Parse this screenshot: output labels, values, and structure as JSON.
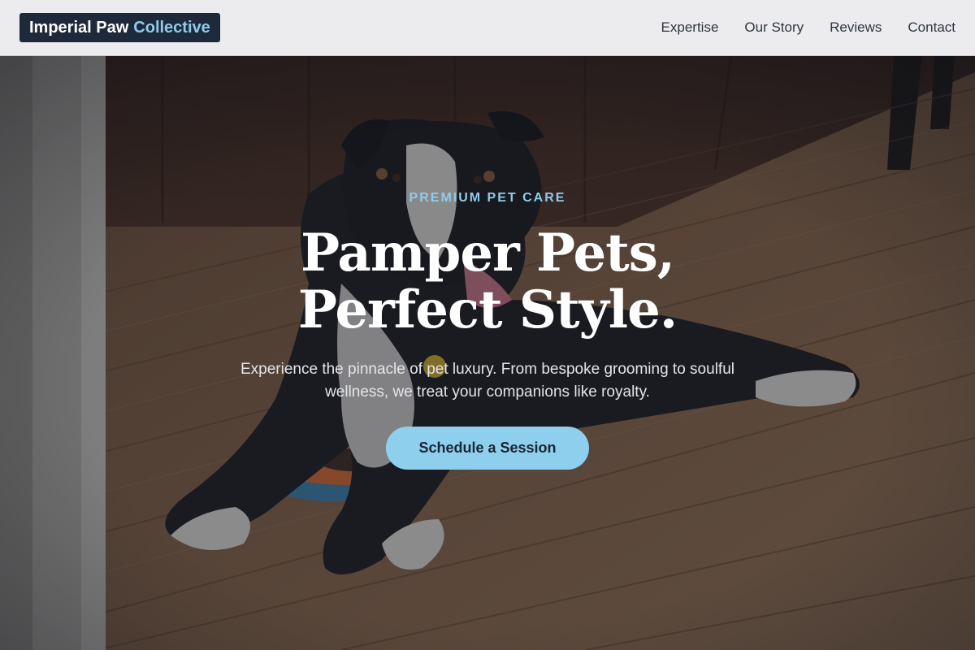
{
  "header": {
    "logo_main": "Imperial Paw",
    "logo_accent": "Collective",
    "nav": [
      "Expertise",
      "Our Story",
      "Reviews",
      "Contact"
    ]
  },
  "hero": {
    "eyebrow": "PREMIUM PET CARE",
    "headline_line1": "Pamper Pets,",
    "headline_line2": "Perfect Style.",
    "subtext": "Experience the pinnacle of pet luxury. From bespoke grooming to soulful wellness, we treat your companions like royalty.",
    "cta_label": "Schedule a Session",
    "background_image": "dog-on-wooden-floor-photo"
  },
  "colors": {
    "logo_bg": "#1e2a3b",
    "accent": "#8fcbea",
    "cta_bg": "#8fcfee",
    "header_bg": "#ececee",
    "overlay": "#181c26"
  }
}
